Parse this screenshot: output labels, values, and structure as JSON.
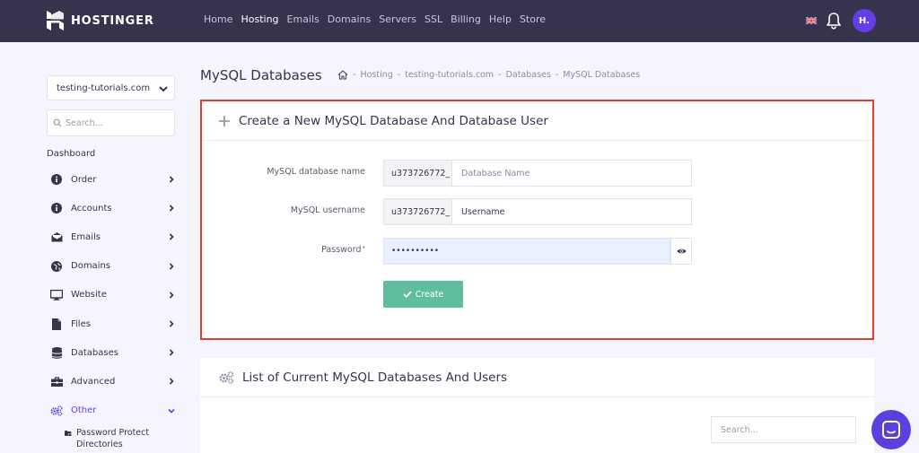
{
  "brand": {
    "name": "HOSTINGER",
    "avatar_initials": "H."
  },
  "nav": {
    "items": [
      {
        "label": "Home"
      },
      {
        "label": "Hosting"
      },
      {
        "label": "Emails"
      },
      {
        "label": "Domains"
      },
      {
        "label": "Servers"
      },
      {
        "label": "SSL"
      },
      {
        "label": "Billing"
      },
      {
        "label": "Help"
      },
      {
        "label": "Store"
      }
    ],
    "active": "Hosting"
  },
  "sidebar": {
    "site": "testing-tutorials.com",
    "search_placeholder": "Search...",
    "dashboard_label": "Dashboard",
    "items": [
      {
        "label": "Order",
        "icon": "info-icon"
      },
      {
        "label": "Accounts",
        "icon": "info-icon"
      },
      {
        "label": "Emails",
        "icon": "envelope-icon"
      },
      {
        "label": "Domains",
        "icon": "globe-icon"
      },
      {
        "label": "Website",
        "icon": "monitor-icon"
      },
      {
        "label": "Files",
        "icon": "file-icon"
      },
      {
        "label": "Databases",
        "icon": "database-icon"
      },
      {
        "label": "Advanced",
        "icon": "toolbox-icon"
      },
      {
        "label": "Other",
        "icon": "gears-icon"
      }
    ],
    "active": "Other",
    "sub_items": [
      {
        "label": "Password Protect Directories",
        "icon": "folder-lock-icon"
      }
    ]
  },
  "page": {
    "title": "MySQL Databases",
    "breadcrumb": [
      "Hosting",
      "testing-tutorials.com",
      "Databases",
      "MySQL Databases"
    ]
  },
  "create_form": {
    "heading": "Create a New MySQL Database And Database User",
    "db_name_label": "MySQL database name",
    "db_prefix": "u373726772_",
    "db_name_placeholder": "Database Name",
    "username_label": "MySQL username",
    "user_prefix": "u373726772_",
    "username_value": "Username",
    "password_label": "Password",
    "password_required_mark": "*",
    "password_value": "••••••••••",
    "create_label": "Create"
  },
  "list": {
    "heading": "List of Current MySQL Databases And Users",
    "search_placeholder": "Search..."
  },
  "colors": {
    "topbar": "#36344d",
    "accent": "#673de6",
    "highlight_border": "#e0412f",
    "create_button": "#5fbf9c"
  }
}
